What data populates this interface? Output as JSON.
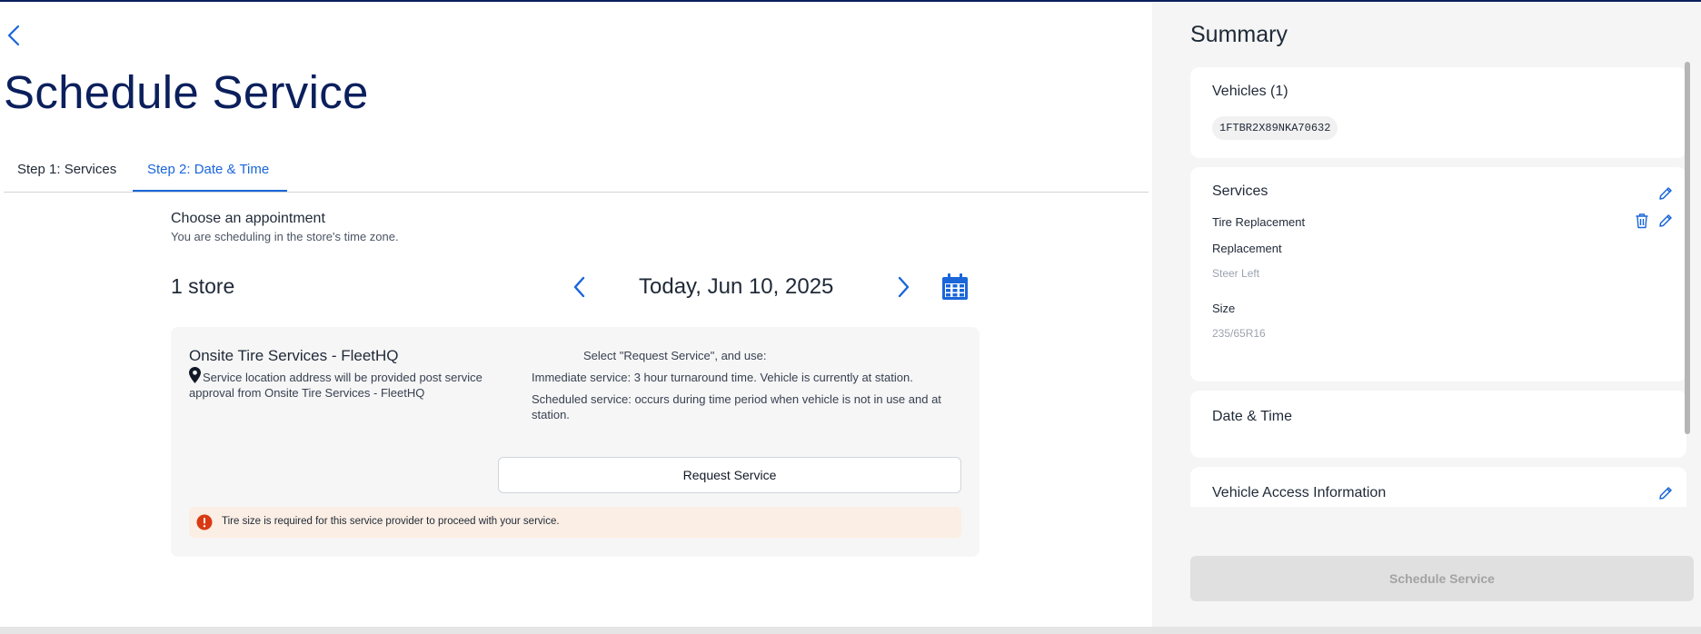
{
  "page": {
    "title": "Schedule Service"
  },
  "tabs": [
    {
      "label": "Step 1: Services",
      "active": false
    },
    {
      "label": "Step 2: Date & Time",
      "active": true
    }
  ],
  "appointment": {
    "title": "Choose an appointment",
    "subtitle": "You are scheduling in the store's time zone.",
    "store_count": "1 store",
    "date": "Today, Jun 10, 2025"
  },
  "store": {
    "name": "Onsite Tire Services - FleetHQ",
    "address_note": "Service location address will be provided post service approval from Onsite Tire Services - FleetHQ",
    "instructions_heading": "Select \"Request Service\", and use:",
    "instruction_immediate": "Immediate service: 3 hour turnaround time. Vehicle is currently at station.",
    "instruction_scheduled": "Scheduled service: occurs during time period when vehicle is not in use and at station.",
    "request_button": "Request Service",
    "alert": "Tire size is required for this service provider to proceed with your service."
  },
  "summary": {
    "title": "Summary",
    "vehicles_title": "Vehicles (1)",
    "vehicles": [
      "1FTBR2X89NKA70632"
    ],
    "services_title": "Services",
    "service_name": "Tire Replacement",
    "replacement_label": "Replacement",
    "replacement_value": "Steer Left",
    "size_label": "Size",
    "size_value": "235/65R16",
    "datetime_title": "Date & Time",
    "access_title": "Vehicle Access Information",
    "schedule_button": "Schedule Service"
  },
  "colors": {
    "primary": "#1a66d9",
    "title_navy": "#0b1f5c",
    "alert_bg": "#fbeee4",
    "alert_icon": "#d93a12",
    "summary_bg": "#f5f5f5"
  },
  "icons": [
    "back-chevron-icon",
    "chevron-left-icon",
    "chevron-right-icon",
    "calendar-icon",
    "location-pin-icon",
    "error-icon",
    "pencil-icon",
    "trash-icon"
  ]
}
